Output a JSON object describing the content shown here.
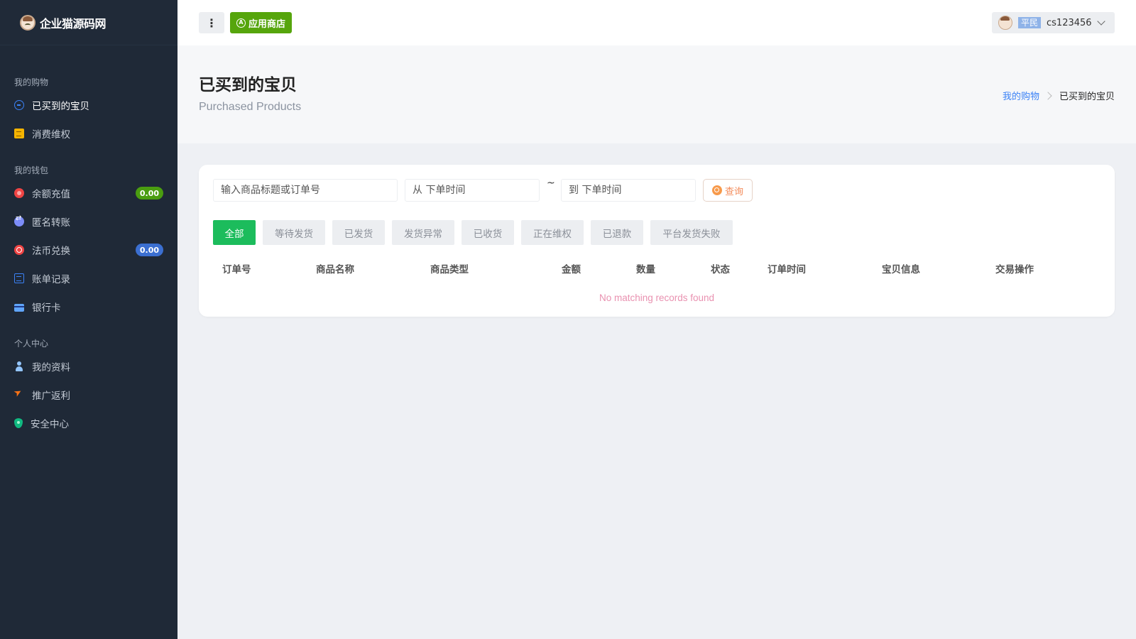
{
  "sidebar": {
    "brand": "企业猫源码网",
    "sections": [
      "我的购物",
      "我的钱包",
      "个人中心"
    ],
    "items": [
      {
        "label": "已买到的宝贝"
      },
      {
        "label": "消费维权"
      },
      {
        "label": "余额充值",
        "badge": "0.00",
        "badge_color": "#4a9d10"
      },
      {
        "label": "匿名转账"
      },
      {
        "label": "法币兑换",
        "badge": "0.00",
        "badge_color": "#3b6fd1"
      },
      {
        "label": "账单记录"
      },
      {
        "label": "银行卡"
      },
      {
        "label": "我的资料"
      },
      {
        "label": "推广返利"
      },
      {
        "label": "安全中心"
      }
    ]
  },
  "header": {
    "menu_icon": "⋮",
    "app_store_label": "应用商店",
    "user": {
      "role": "平民",
      "username": "cs123456"
    }
  },
  "page": {
    "title": "已买到的宝贝",
    "subtitle": "Purchased Products",
    "breadcrumb": {
      "parent": "我的购物",
      "current": "已买到的宝贝"
    }
  },
  "filters": {
    "keyword_placeholder": "输入商品标题或订单号",
    "from_placeholder": "从 下单时间",
    "range_sep": "~",
    "to_placeholder": "到 下单时间",
    "query_label": "查询"
  },
  "tabs": [
    "全部",
    "等待发货",
    "已发货",
    "发货异常",
    "已收货",
    "正在维权",
    "已退款",
    "平台发货失败"
  ],
  "table": {
    "columns": [
      "订单号",
      "商品名称",
      "商品类型",
      "金额",
      "数量",
      "状态",
      "订单时间",
      "宝贝信息",
      "交易操作"
    ],
    "empty_text": "No matching records found"
  },
  "colors": {
    "sidebar_bg": "#1f2937",
    "accent_green": "#1cbc5c",
    "app_store_green": "#56a50c",
    "link_blue": "#3b82f6"
  }
}
